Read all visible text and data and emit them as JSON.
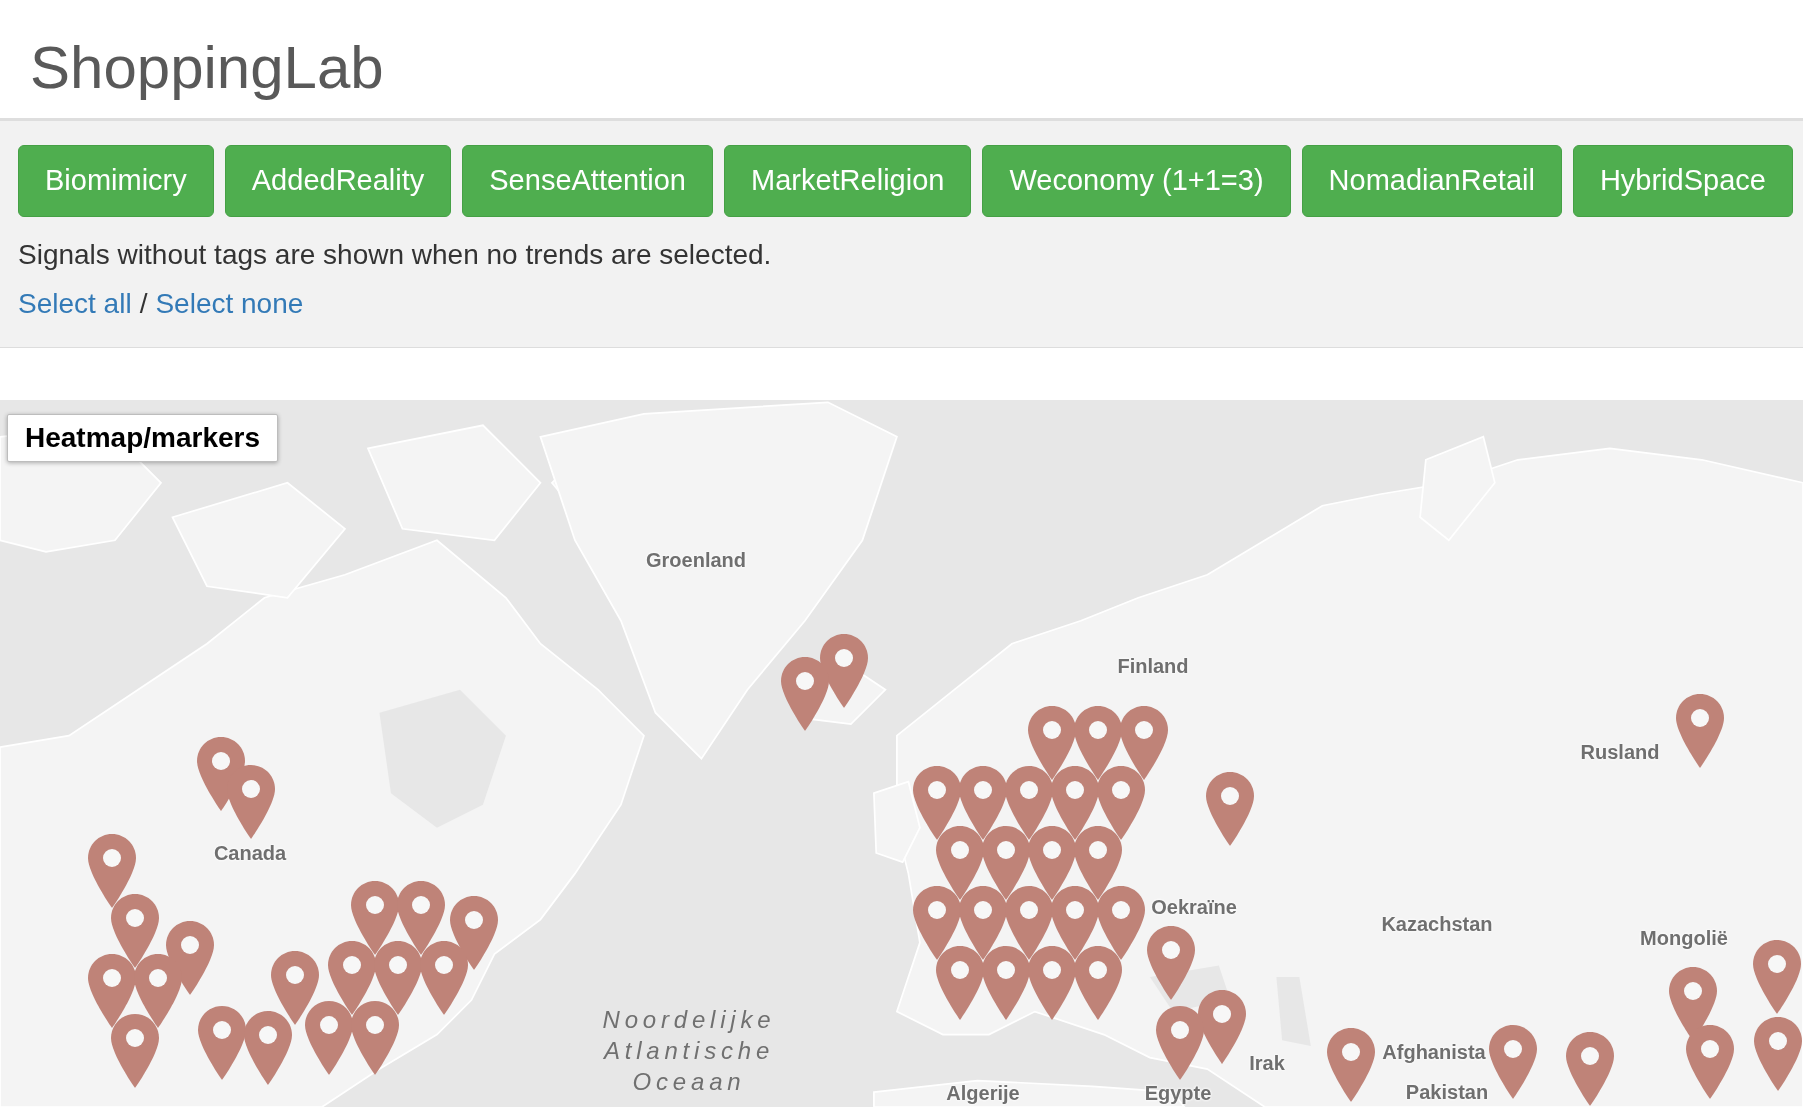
{
  "header": {
    "title": "ShoppingLab"
  },
  "trends": [
    {
      "label": "Biomimicry",
      "selected": true
    },
    {
      "label": "AddedReality",
      "selected": true
    },
    {
      "label": "SenseAttention",
      "selected": true
    },
    {
      "label": "MarketReligion",
      "selected": true
    },
    {
      "label": "Weconomy (1+1=3)",
      "selected": true
    },
    {
      "label": "NomadianRetail",
      "selected": true
    },
    {
      "label": "HybridSpace",
      "selected": true
    }
  ],
  "note": "Signals without tags are shown when no trends are selected.",
  "selection_links": {
    "all": "Select all",
    "separator": "/",
    "none": "Select none"
  },
  "map": {
    "toggle_button": "Heatmap/markers",
    "labels": [
      {
        "text": "Groenland",
        "kind": "country"
      },
      {
        "text": "Finland",
        "kind": "country"
      },
      {
        "text": "Rusland",
        "kind": "country"
      },
      {
        "text": "Canada",
        "kind": "country"
      },
      {
        "text": "Oekraïne",
        "kind": "country"
      },
      {
        "text": "Kazachstan",
        "kind": "country"
      },
      {
        "text": "Mongolië",
        "kind": "country"
      },
      {
        "text": "Noordelijke Atlantische Oceaan",
        "kind": "ocean"
      },
      {
        "text": "Irak",
        "kind": "country"
      },
      {
        "text": "Afghanista",
        "kind": "country"
      },
      {
        "text": "Algerije",
        "kind": "country"
      },
      {
        "text": "Egypte",
        "kind": "country"
      },
      {
        "text": "Pakistan",
        "kind": "country"
      }
    ]
  }
}
